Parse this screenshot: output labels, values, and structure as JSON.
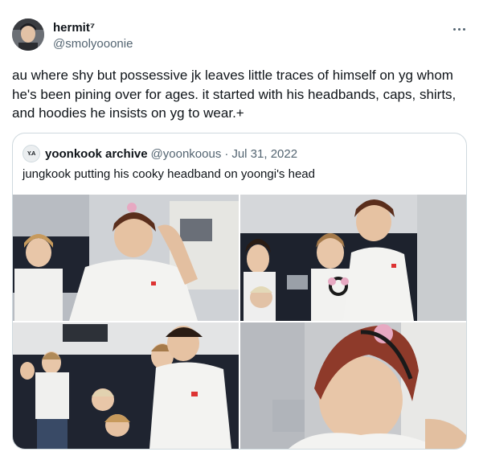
{
  "author": {
    "name": "hermit⁷",
    "handle": "@smolyooonie",
    "avatar_icon": "profile-avatar"
  },
  "tweet_text": "au where shy but possessive jk leaves little traces of himself on yg whom he's been pining over for ages. it started with his headbands, caps, shirts, and hoodies he insists on yg to wear.+",
  "more_icon": "more-options-icon",
  "quote": {
    "avatar_text": "Y.A",
    "name": "yoonkook archive",
    "handle": "@yoonkoous",
    "separator": "·",
    "date": "Jul 31, 2022",
    "text": "jungkook putting his cooky headband on yoongi's head",
    "photos": [
      {
        "label": "photo-1"
      },
      {
        "label": "photo-2"
      },
      {
        "label": "photo-3"
      },
      {
        "label": "photo-4"
      }
    ]
  },
  "colors": {
    "text": "#0f1419",
    "secondary": "#536471",
    "border": "#cfd9de"
  }
}
